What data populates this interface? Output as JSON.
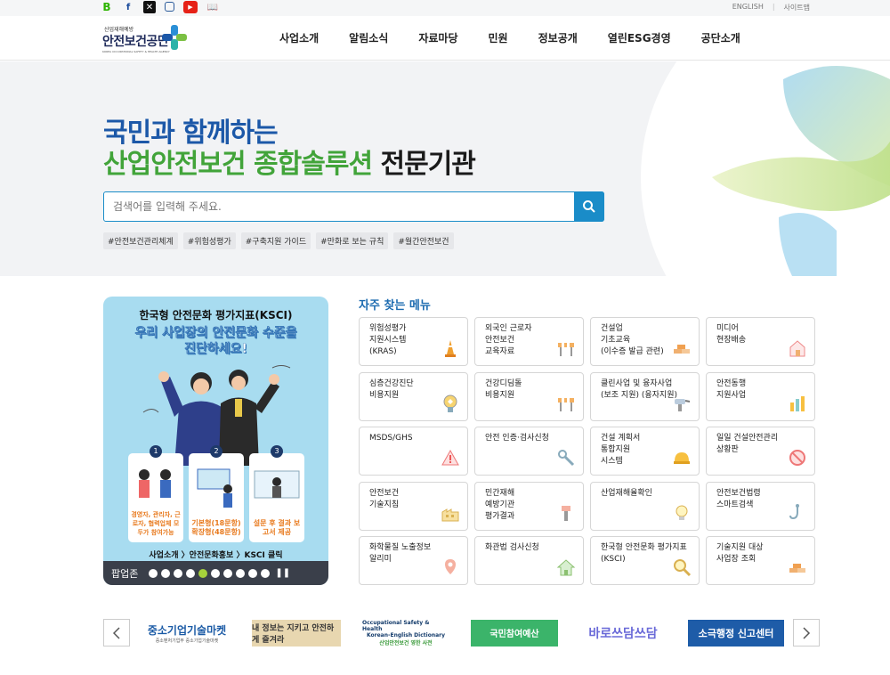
{
  "topbar": {
    "links": [
      "ENGLISH",
      "사이트맵"
    ]
  },
  "header": {
    "logo_small": "산업재해예방",
    "logo_name": "안전보건공단",
    "logo_eng": "KOREA OCCUPATIONAL SAFETY & HEALTH AGENCY",
    "nav": [
      "사업소개",
      "알림소식",
      "자료마당",
      "민원",
      "정보공개",
      "열린ESG경영",
      "공단소개"
    ]
  },
  "hero": {
    "line1": "국민과 함께하는",
    "line2_green": "산업안전보건 종합솔루션",
    "line2_dark": "전문기관",
    "search_placeholder": "검색어를 입력해 주세요.",
    "tags": [
      "#안전보건관리체계",
      "#위험성평가",
      "#구축지원 가이드",
      "#만화로 보는 규칙",
      "#월간안전보건"
    ]
  },
  "banner": {
    "title": "한국형 안전문화 평가지표(KSCI)",
    "headline_1": "우리 사업장의 안전문화 수준을",
    "headline_2": "진단하세요!",
    "cards": [
      {
        "num": "1",
        "text": "경영자, 관리자, 근로자, 협력업체 모두가 참여가능"
      },
      {
        "num": "2",
        "text": "기본형(18문항) 확장형(48문항)"
      },
      {
        "num": "3",
        "text": "설문 후 결과 보고서 제공"
      }
    ],
    "crumb": "사업소개 〉안전문화홍보 〉KSCI 클릭",
    "footer_label": "팝업존",
    "dot_count": 10,
    "active_dot": 4
  },
  "frequent": {
    "title": "자주 찾는 메뉴",
    "items": [
      {
        "label": "위험성평가\n지원시스템\n(KRAS)",
        "icon": "cone-icon"
      },
      {
        "label": "외국인 근로자\n안전보건\n교육자료",
        "icon": "barrier-icon"
      },
      {
        "label": "건설업\n기초교육\n(이수증 발급 관련)",
        "icon": "bricks-icon"
      },
      {
        "label": "미디어\n현장배송",
        "icon": "house-icon"
      },
      {
        "label": "심층건강진단\n비용지원",
        "icon": "badge-icon"
      },
      {
        "label": "건강디딤돌\n비용지원",
        "icon": "barrier-icon"
      },
      {
        "label": "클린사업 및 융자사업\n(보조 지원) (융자지원)",
        "icon": "drill-icon"
      },
      {
        "label": "안전동행\n지원사업",
        "icon": "chart-icon"
      },
      {
        "label": "MSDS/GHS",
        "icon": "warning-icon"
      },
      {
        "label": "안전 인증·검사신청",
        "icon": "wrench-icon"
      },
      {
        "label": "건설 계획서\n통합지원\n시스템",
        "icon": "helmet-icon"
      },
      {
        "label": "일일 건설안전관리\n상황판",
        "icon": "no-icon"
      },
      {
        "label": "안전보건\n기술지침",
        "icon": "factory-icon"
      },
      {
        "label": "민간재해\n예방기관\n평가결과",
        "icon": "tool-icon"
      },
      {
        "label": "산업재해율확인",
        "icon": "bulb-icon"
      },
      {
        "label": "안전보건법령\n스마트검색",
        "icon": "hook-icon"
      },
      {
        "label": "화학물질 노출정보\n알리미",
        "icon": "pin-icon"
      },
      {
        "label": "화관법 검사신청",
        "icon": "home-icon"
      },
      {
        "label": "한국형 안전문화 평가지표\n(KSCI)",
        "icon": "magnifier-icon"
      },
      {
        "label": "기술지원 대상\n사업장 조회",
        "icon": "bricks-icon"
      }
    ]
  },
  "partners": {
    "logo1": "중소기업기술마켓",
    "logo1_sub": "중소벤처기업부 중소기업기술마켓",
    "logo2": "내 정보는 지키고 안전하게 즐겨라",
    "logo3_1": "Occupational Safety & Health",
    "logo3_2": "Korean-English Dictionary",
    "logo3_3": "산업안전보건 영한 사전",
    "logo4": "국민참여예산",
    "logo5": "바로쓰담쓰담",
    "logo6": "소극행정 신고센터"
  },
  "colors": {
    "primary_blue": "#1c58a8",
    "accent_green": "#42a43a",
    "search_blue": "#1a8cc8",
    "banner_bg": "#a8dcf0"
  }
}
